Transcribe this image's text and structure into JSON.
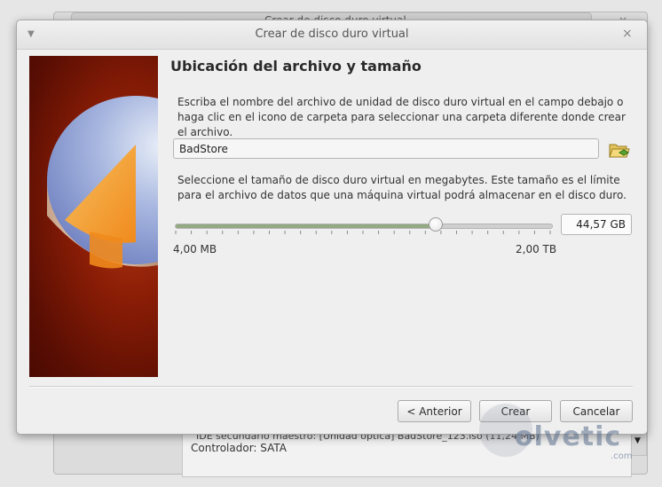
{
  "background_window": {
    "title": "Crear de disco duro virtual",
    "close_glyph": "×",
    "detail_line": "IDE secundario maestro:    [Unidad óptica] BadStore_123.iso (11,24 MB)",
    "controller_line": "Controlador: SATA",
    "scroll_arrow": "▼"
  },
  "dialog": {
    "title": "Crear de disco duro virtual",
    "menu_glyph": "▼",
    "close_glyph": "×",
    "heading": "Ubicación del archivo y tamaño",
    "location_description": "Escriba el nombre del archivo de unidad de disco duro virtual en el campo debajo o haga clic en el icono de carpeta para seleccionar una carpeta diferente donde crear el archivo.",
    "file_name": "BadStore",
    "folder_icon": "folder-open-icon",
    "size_description": "Seleccione el tamaño de disco duro virtual en megabytes. Este tamaño es el límite para el archivo de datos que una máquina virtual podrá almacenar en el disco duro.",
    "size_value": "44,57 GB",
    "slider_position": 0.694,
    "slider_fill_color": "#93a982",
    "min_label": "4,00 MB",
    "max_label": "2,00 TB",
    "buttons": {
      "back": "< Anterior",
      "create": "Crear",
      "cancel": "Cancelar"
    }
  },
  "watermark": {
    "text": "olvetic",
    "suffix": ".com"
  }
}
